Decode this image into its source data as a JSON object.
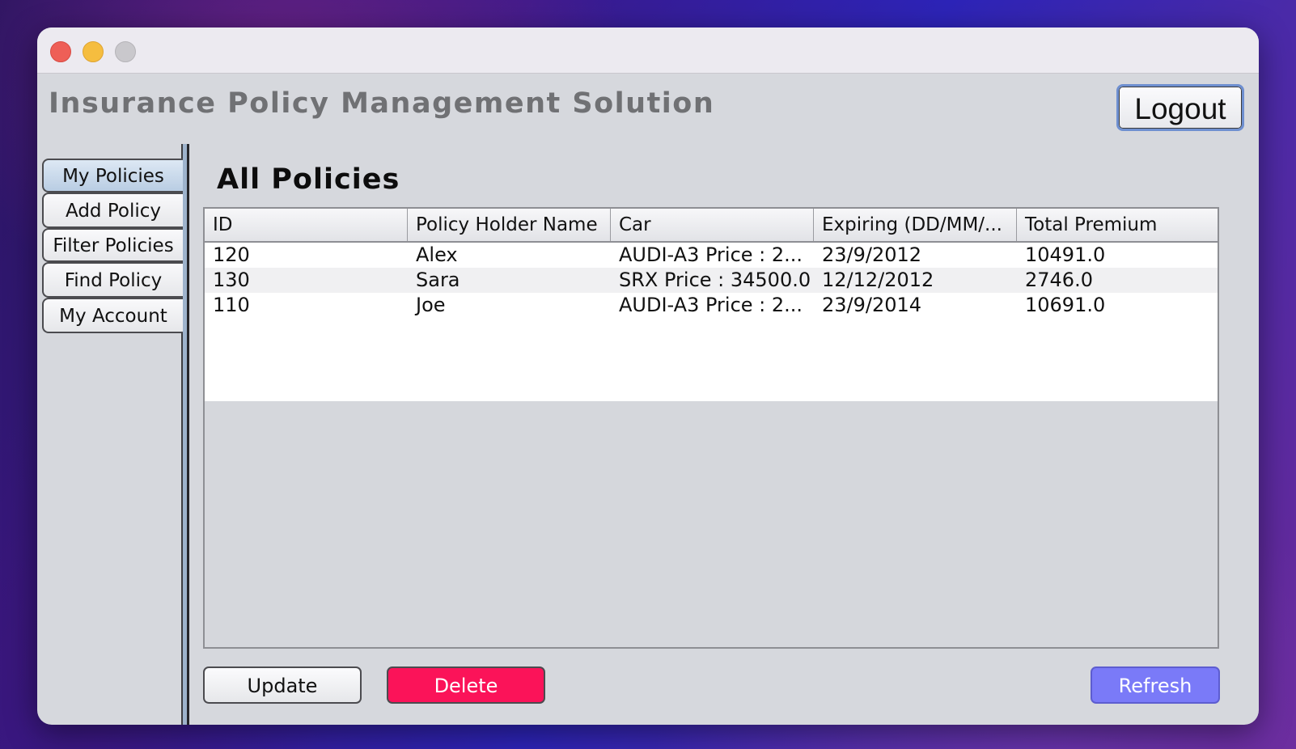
{
  "window": {
    "app_title": "Insurance Policy Management Solution",
    "logout_label": "Logout"
  },
  "sidebar": {
    "tabs": [
      {
        "label": "My Policies",
        "active": true
      },
      {
        "label": "Add Policy",
        "active": false
      },
      {
        "label": "Filter Policies",
        "active": false
      },
      {
        "label": "Find Policy",
        "active": false
      },
      {
        "label": "My Account",
        "active": false
      }
    ]
  },
  "main": {
    "section_title": "All Policies",
    "table": {
      "columns": [
        "ID",
        "Policy Holder Name",
        "Car",
        "Expiring (DD/MM/...",
        "Total Premium"
      ],
      "rows": [
        [
          "120",
          "Alex",
          "AUDI-A3 Price : 2...",
          "23/9/2012",
          "10491.0"
        ],
        [
          "130",
          "Sara",
          "SRX Price : 34500.0",
          "12/12/2012",
          "2746.0"
        ],
        [
          "110",
          "Joe",
          "AUDI-A3 Price : 2...",
          "23/9/2014",
          "10691.0"
        ]
      ]
    },
    "buttons": {
      "update_label": "Update",
      "delete_label": "Delete",
      "refresh_label": "Refresh"
    }
  },
  "colors": {
    "delete_button": "#fb1359",
    "refresh_button": "#7a7af8",
    "active_tab": "#c6d7ea"
  }
}
